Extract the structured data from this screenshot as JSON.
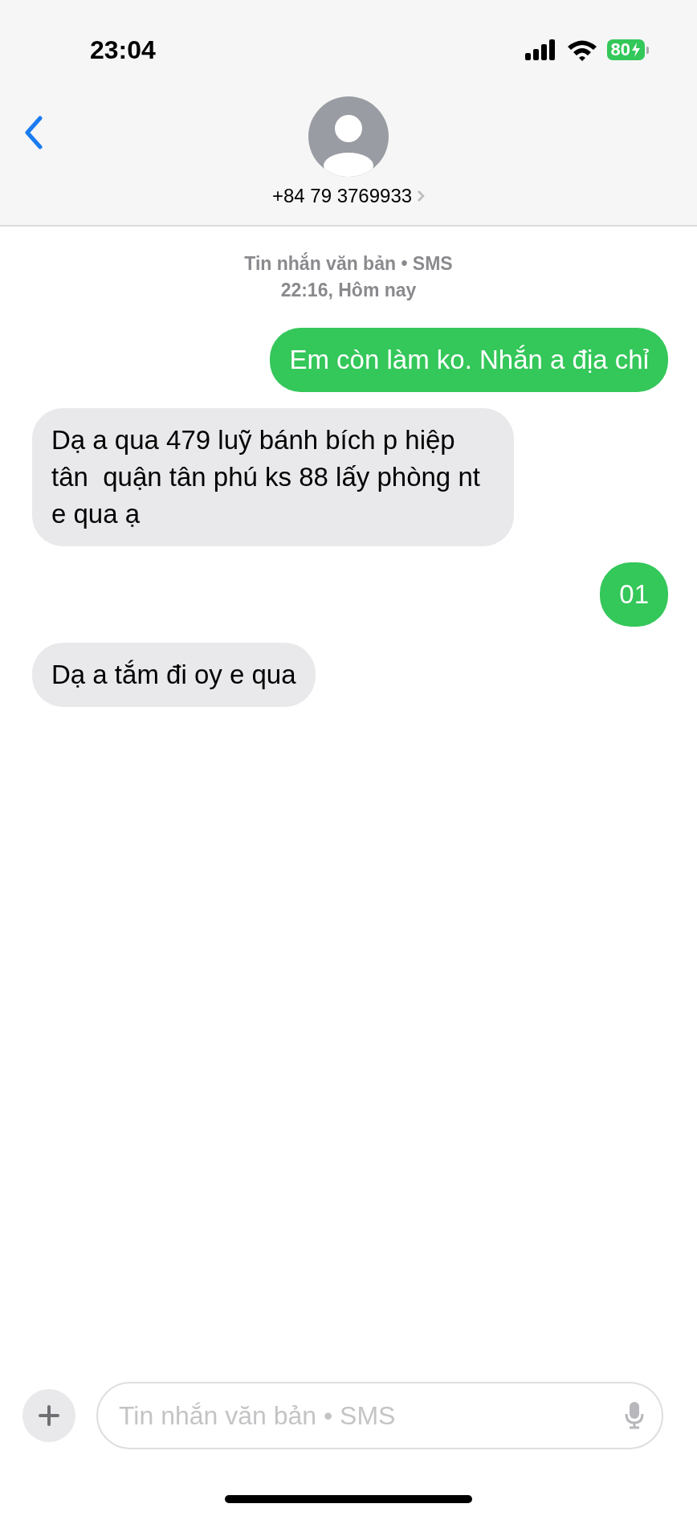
{
  "status_bar": {
    "time": "23:04",
    "battery": "80"
  },
  "header": {
    "contact": "+84 79 3769933"
  },
  "meta": {
    "service": "Tin nhắn văn bản • SMS",
    "timestamp": "22:16, Hôm nay"
  },
  "messages": [
    {
      "kind": "outgoing",
      "text": "Em còn làm ko. Nhắn a địa chỉ"
    },
    {
      "kind": "incoming",
      "text": "Dạ a qua 479 luỹ bánh bích p hiệp tân  quận tân phú ks 88 lấy phòng nt e qua ạ"
    },
    {
      "kind": "outgoing",
      "text": "01"
    },
    {
      "kind": "incoming",
      "text": "Dạ a tắm đi oy e qua"
    }
  ],
  "composer": {
    "placeholder": "Tin nhắn văn bản • SMS"
  }
}
